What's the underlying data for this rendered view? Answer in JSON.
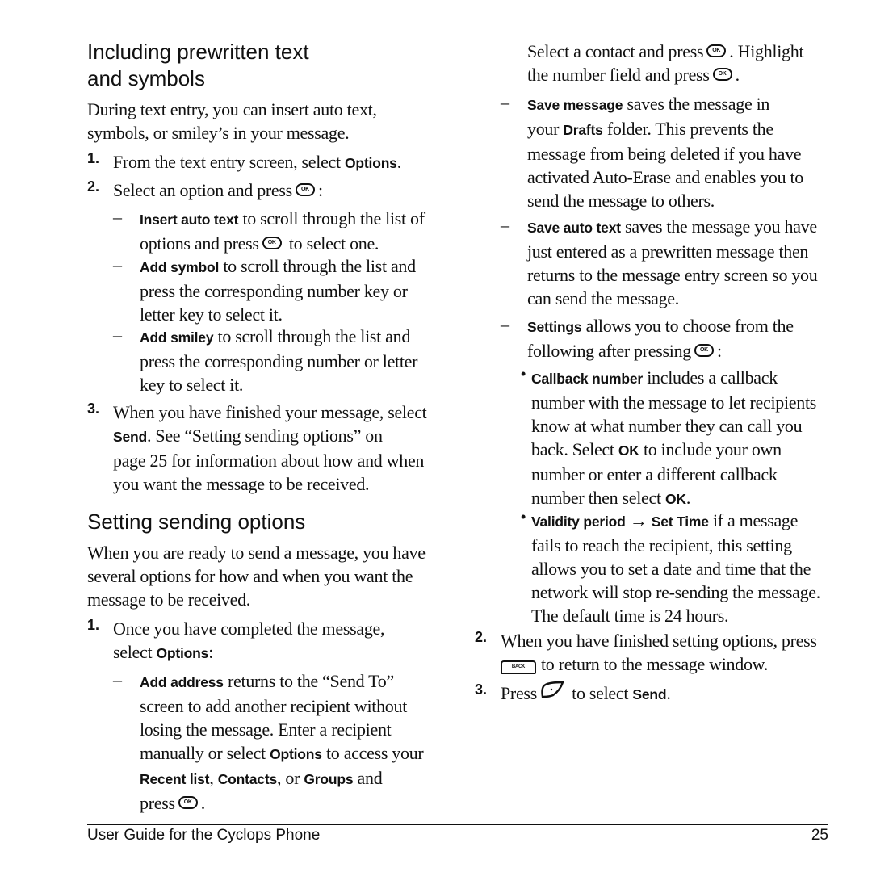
{
  "left": {
    "section1": {
      "title_line1": "Including prewritten text",
      "title_line2": "and symbols",
      "intro_line1": "During text entry, you can insert auto text,",
      "intro_line2": "symbols, or smiley’s in your message.",
      "step1": {
        "num": "1.",
        "text": "From the text entry screen, select ",
        "bold": "Options",
        "end": "."
      },
      "step2": {
        "num": "2.",
        "text": "Select an option and press",
        "end": ":"
      },
      "options": [
        {
          "bold": "Insert auto text",
          "line1": " to scroll through the list of",
          "line2a": "options and press",
          "line2b": " to select one."
        },
        {
          "bold": "Add symbol",
          "line1": " to scroll through the list and",
          "line2": "press the corresponding number key or",
          "line3": "letter key to select it."
        },
        {
          "bold": "Add smiley",
          "line1": " to scroll through the list and",
          "line2": "press the corresponding number or letter",
          "line3": "key to select it."
        }
      ],
      "step3": {
        "num": "3.",
        "line1": "When you have finished your message, select",
        "bold": "Send",
        "line2": ". See “Setting sending options” on",
        "line3": "page 25 for information about how and when",
        "line4": "you want the message to be received."
      }
    },
    "section2": {
      "title": "Setting sending options",
      "intro_line1": "When you are ready to send a message, you have",
      "intro_line2": "several options for how and when you want the",
      "intro_line3": "message to be received.",
      "step1": {
        "num": "1.",
        "line1": "Once you have completed the message,",
        "line2a": "select ",
        "bold": "Options",
        "end": ":"
      },
      "add_address": {
        "bold": "Add address",
        "line1": " returns to the “Send To”",
        "line2": "screen to add another recipient without",
        "line3": "losing the message. Enter a recipient",
        "line4a": "manually or select ",
        "line4bold": "Options",
        "line4b": " to access your",
        "line5bold1": "Recent list",
        "line5sep1": ", ",
        "line5bold2": "Contacts",
        "line5sep2": ", or ",
        "line5bold3": "Groups",
        "line5end": " and",
        "line6": "press",
        "line6end": "."
      }
    }
  },
  "right": {
    "contact_line1a": "Select a contact and press",
    "contact_line1b": ". Highlight",
    "contact_line2a": "the number field and press",
    "contact_line2b": ".",
    "save_message": {
      "bold": "Save message",
      "line1": " saves the message in",
      "line2a": "your ",
      "line2bold": "Drafts",
      "line2b": " folder. This prevents the",
      "line3": "message from being deleted if you have",
      "line4": "activated Auto-Erase and enables you to",
      "line5": "send the message to others."
    },
    "save_auto_text": {
      "bold": "Save auto text",
      "line1": " saves the message you have",
      "line2": "just entered as a prewritten message then",
      "line3": "returns to the message entry screen so you",
      "line4": "can send the message."
    },
    "settings": {
      "bold": "Settings",
      "line1": " allows you to choose from the",
      "line2": "following after pressing",
      "line2end": ":"
    },
    "callback": {
      "bold": "Callback number",
      "line1": " includes a callback",
      "line2": "number with the message to let recipients",
      "line3": "know at what number they can call you",
      "line4a": "back. Select ",
      "line4bold": "OK",
      "line4b": " to include your own",
      "line5": "number or enter a different callback",
      "line6a": "number then select ",
      "line6bold": "OK",
      "line6b": "."
    },
    "validity": {
      "bold1": "Validity period",
      "arrow": " → ",
      "bold2": "Set Time",
      "line1": " if a message",
      "line2": "fails to reach the recipient, this setting",
      "line3": "allows you to set a date and time that the",
      "line4": "network will stop re-sending the message.",
      "line5": "The default time is 24 hours."
    },
    "step2": {
      "num": "2.",
      "line1": "When you have finished setting options, press",
      "line2": "to return to the message window."
    },
    "step3": {
      "num": "3.",
      "text": "Press",
      "text2": " to select ",
      "bold": "Send",
      "end": "."
    }
  },
  "icons": {
    "ok_label": "OK",
    "back_label": "BACK"
  },
  "bullet": "•",
  "dash": "–",
  "footer": {
    "title": "User Guide for the Cyclops Phone",
    "page": "25"
  }
}
